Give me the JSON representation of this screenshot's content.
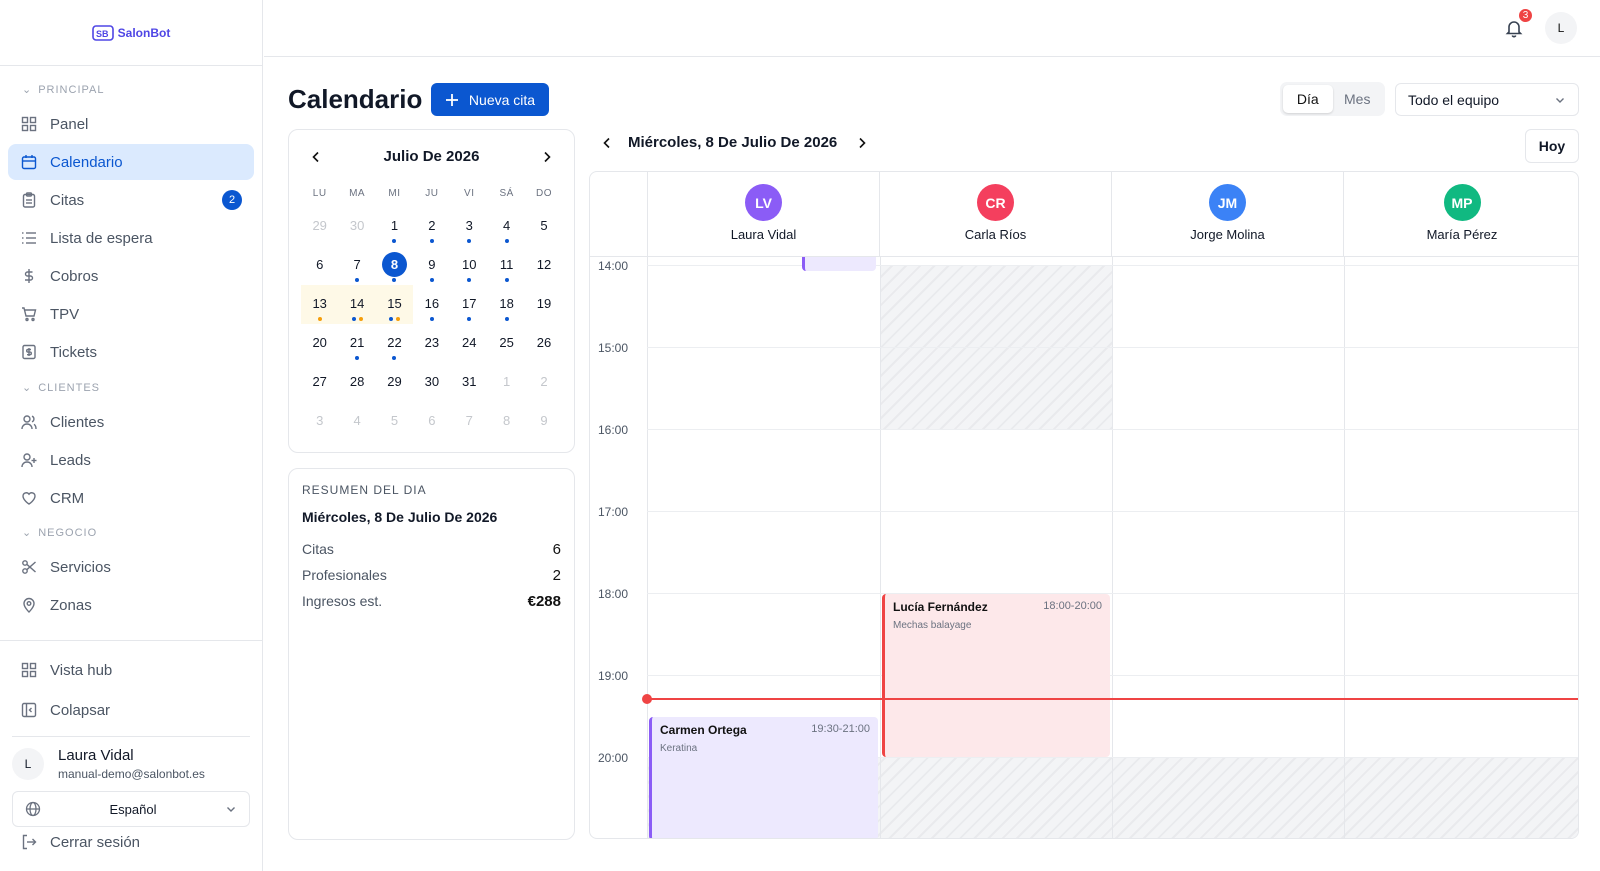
{
  "app": {
    "brand": "SalonBot"
  },
  "sidebar": {
    "sections": {
      "principal": "PRINCIPAL",
      "clientes": "CLIENTES",
      "negocio": "NEGOCIO"
    },
    "items": [
      {
        "label": "Panel",
        "icon": "grid-icon"
      },
      {
        "label": "Calendario",
        "icon": "calendar-icon",
        "active": true
      },
      {
        "label": "Citas",
        "icon": "clipboard-icon",
        "badge": "2"
      },
      {
        "label": "Lista de espera",
        "icon": "list-icon"
      },
      {
        "label": "Cobros",
        "icon": "dollar-icon"
      },
      {
        "label": "TPV",
        "icon": "cart-icon"
      },
      {
        "label": "Tickets",
        "icon": "receipt-icon"
      },
      {
        "label": "Clientes",
        "icon": "users-icon"
      },
      {
        "label": "Leads",
        "icon": "user-plus-icon"
      },
      {
        "label": "CRM",
        "icon": "heart-icon"
      },
      {
        "label": "Servicios",
        "icon": "scissors-icon"
      },
      {
        "label": "Zonas",
        "icon": "map-pin-icon"
      }
    ],
    "footer": {
      "hub": "Vista hub",
      "collapse": "Colapsar",
      "logout": "Cerrar sesión"
    },
    "user": {
      "initial": "L",
      "name": "Laura Vidal",
      "email": "manual-demo@salonbot.es"
    },
    "language": "Español"
  },
  "topbar": {
    "notifications": "3",
    "avatar_initial": "L"
  },
  "page": {
    "title": "Calendario",
    "new_button": "Nueva cita",
    "view_day": "Día",
    "view_month": "Mes",
    "team_filter": "Todo el equipo",
    "today_button": "Hoy",
    "day_title": "Miércoles, 8 De Julio De 2026"
  },
  "mini_calendar": {
    "month": "Julio De 2026",
    "weekdays": [
      "LU",
      "MA",
      "MI",
      "JU",
      "VI",
      "SÁ",
      "DO"
    ]
  },
  "summary": {
    "label": "RESUMEN DEL DIA",
    "date": "Miércoles, 8 De Julio De 2026",
    "rows": [
      {
        "label": "Citas",
        "value": "6"
      },
      {
        "label": "Profesionales",
        "value": "2"
      },
      {
        "label": "Ingresos est.",
        "value": "€288"
      }
    ]
  },
  "staff": [
    {
      "initials": "LV",
      "name": "Laura Vidal",
      "color": "#8b5cf6"
    },
    {
      "initials": "CR",
      "name": "Carla Ríos",
      "color": "#f43f5e"
    },
    {
      "initials": "JM",
      "name": "Jorge Molina",
      "color": "#3b82f6"
    },
    {
      "initials": "MP",
      "name": "María Pérez",
      "color": "#10b981"
    }
  ],
  "hours": [
    "14:00",
    "15:00",
    "16:00",
    "17:00",
    "18:00",
    "19:00",
    "20:00"
  ],
  "appointments": [
    {
      "client": "Lucía Fernández",
      "time": "18:00-20:00",
      "service": "Mechas balayage"
    },
    {
      "client": "Carmen Ortega",
      "time": "19:30-21:00",
      "service": "Keratina"
    }
  ],
  "colors": {
    "accent": "#0b57d0",
    "now_line": "#ef4444",
    "dot_blue": "#0b57d0",
    "dot_orange": "#f59e0b"
  }
}
